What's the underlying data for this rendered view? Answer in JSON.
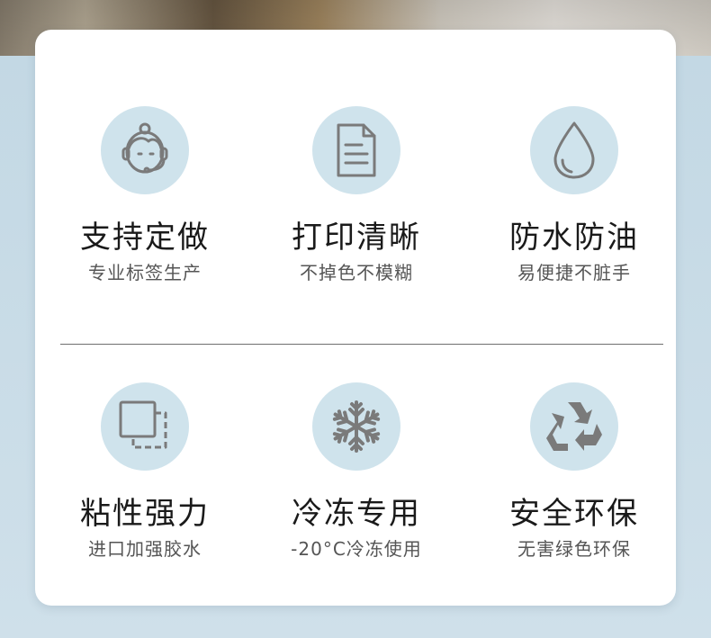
{
  "features": [
    {
      "title": "支持定做",
      "subtitle": "专业标签生产",
      "icon": "customer-service-icon"
    },
    {
      "title": "打印清晰",
      "subtitle": "不掉色不模糊",
      "icon": "document-icon"
    },
    {
      "title": "防水防油",
      "subtitle": "易便捷不脏手",
      "icon": "water-drop-icon"
    },
    {
      "title": "粘性强力",
      "subtitle": "进口加强胶水",
      "icon": "sticky-label-icon"
    },
    {
      "title": "冷冻专用",
      "subtitle": "-20°C冷冻使用",
      "icon": "snowflake-icon"
    },
    {
      "title": "安全环保",
      "subtitle": "无害绿色环保",
      "icon": "recycle-icon"
    }
  ],
  "colors": {
    "icon_bg": "#cfe3ec",
    "icon_stroke": "#7a7a7a",
    "page_bg": "#c7dbe6"
  }
}
